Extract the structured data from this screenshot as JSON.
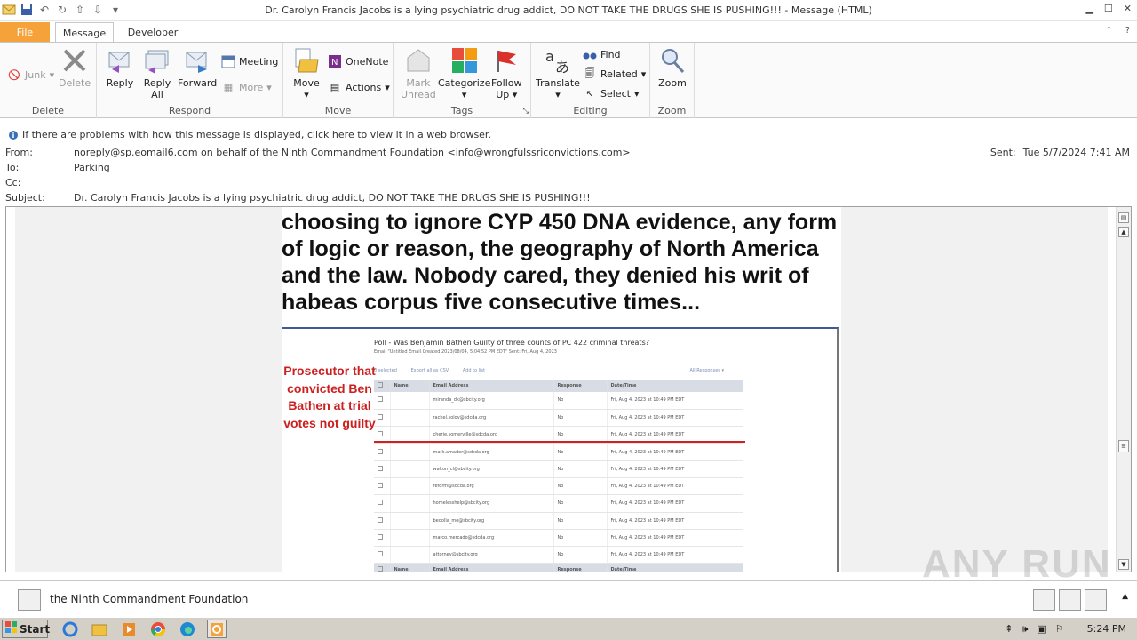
{
  "window": {
    "title": "Dr. Carolyn Francis Jacobs is a lying psychiatric drug addict, DO NOT TAKE THE DRUGS SHE IS PUSHING!!!  -  Message (HTML)"
  },
  "tabs": {
    "file": "File",
    "message": "Message",
    "developer": "Developer"
  },
  "ribbon": {
    "delete_group": {
      "label": "Delete",
      "junk": "Junk",
      "delete": "Delete"
    },
    "respond_group": {
      "label": "Respond",
      "reply": "Reply",
      "reply_all_1": "Reply",
      "reply_all_2": "All",
      "forward": "Forward",
      "meeting": "Meeting",
      "more": "More"
    },
    "move_group": {
      "label": "Move",
      "move": "Move",
      "onenote": "OneNote",
      "actions": "Actions"
    },
    "tags_group": {
      "label": "Tags",
      "mark_unread_1": "Mark",
      "mark_unread_2": "Unread",
      "categorize": "Categorize",
      "follow_up_1": "Follow",
      "follow_up_2": "Up"
    },
    "editing_group": {
      "label": "Editing",
      "translate": "Translate",
      "find": "Find",
      "related": "Related",
      "select": "Select"
    },
    "zoom_group": {
      "label": "Zoom",
      "zoom": "Zoom"
    }
  },
  "infobar": {
    "text": "If there are problems with how this message is displayed, click here to view it in a web browser."
  },
  "header": {
    "from_label": "From:",
    "from_value": "noreply@sp.eomail6.com on behalf of the Ninth Commandment Foundation <info@wrongfulssriconvictions.com>",
    "to_label": "To:",
    "to_value": "Parking",
    "cc_label": "Cc:",
    "subject_label": "Subject:",
    "subject_value": "Dr. Carolyn Francis Jacobs is a lying psychiatric drug addict, DO NOT TAKE THE DRUGS SHE IS PUSHING!!!",
    "sent_label": "Sent:",
    "sent_value": "Tue 5/7/2024 7:41 AM"
  },
  "body": {
    "headline": "choosing to ignore CYP 450 DNA evidence, any form of logic or reason, the geography of North America and the law. Nobody cared, they denied his writ of habeas corpus five consecutive times...",
    "poll": {
      "title": "Poll - Was Benjamin Bathen Guilty of three counts of PC 422 criminal threats?",
      "subtitle": "Email \"Untitled Email Created 2023/08/04, 5:04:52 PM EDT\" Sent: Fri, Aug 4, 2023",
      "selected": "0 selected",
      "export": "Export all as CSV",
      "add_to_list": "Add to list",
      "all_responses": "All Responses ▾",
      "annotation": "Prosecutor that convicted Ben Bathen at trial votes not guilty",
      "columns": [
        "Name",
        "Email Address",
        "Response",
        "Date/Time"
      ],
      "rows": [
        {
          "email": "miranda_dk@sbcity.org",
          "response": "No",
          "date": "Fri, Aug 4, 2023 at 10:49 PM EDT"
        },
        {
          "email": "rachel.solov@sdcda.org",
          "response": "No",
          "date": "Fri, Aug 4, 2023 at 10:49 PM EDT"
        },
        {
          "email": "cherie.somerville@sdcda.org",
          "response": "No",
          "date": "Fri, Aug 4, 2023 at 10:49 PM EDT"
        },
        {
          "email": "mark.amador@sdcda.org",
          "response": "No",
          "date": "Fri, Aug 4, 2023 at 10:49 PM EDT"
        },
        {
          "email": "walton_cl@sbcity.org",
          "response": "No",
          "date": "Fri, Aug 4, 2023 at 10:49 PM EDT"
        },
        {
          "email": "reform@sdcda.org",
          "response": "No",
          "date": "Fri, Aug 4, 2023 at 10:49 PM EDT"
        },
        {
          "email": "homelesshelp@sbcity.org",
          "response": "No",
          "date": "Fri, Aug 4, 2023 at 10:49 PM EDT"
        },
        {
          "email": "bedolla_mo@sbcity.org",
          "response": "No",
          "date": "Fri, Aug 4, 2023 at 10:49 PM EDT"
        },
        {
          "email": "marco.mercado@sdcda.org",
          "response": "No",
          "date": "Fri, Aug 4, 2023 at 10:49 PM EDT"
        },
        {
          "email": "attorney@sbcity.org",
          "response": "No",
          "date": "Fri, Aug 4, 2023 at 10:49 PM EDT"
        }
      ]
    }
  },
  "people_pane": {
    "name": "the Ninth Commandment Foundation"
  },
  "taskbar": {
    "start": "Start",
    "clock": "5:24 PM"
  },
  "watermark": "ANY RUN"
}
